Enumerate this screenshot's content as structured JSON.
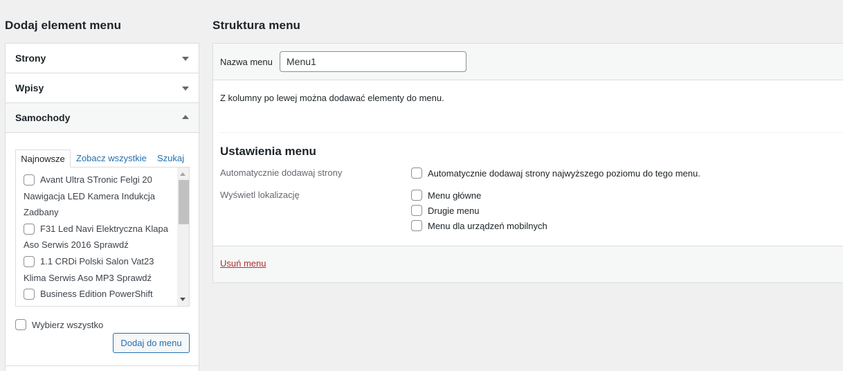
{
  "left": {
    "heading": "Dodaj element menu",
    "sections": [
      {
        "label": "Strony",
        "state": "collapsed"
      },
      {
        "label": "Wpisy",
        "state": "collapsed"
      },
      {
        "label": "Samochody",
        "state": "expanded"
      }
    ],
    "tabs": [
      "Najnowsze",
      "Zobacz wszystkie",
      "Szukaj"
    ],
    "items": [
      {
        "line1": "Avant Ultra STronic Felgi 20",
        "line2": "Nawigacja LED Kamera Indukcja",
        "line3": "Zadbany"
      },
      {
        "line1": "F31 Led Navi Elektryczna Klapa",
        "line2": "Aso Serwis 2016 Sprawdź"
      },
      {
        "line1": "1.1 CRDi Polski Salon Vat23",
        "line2": "Klima Serwis Aso MP3 Sprawdź"
      },
      {
        "line1": "Business Edition PowerShift"
      }
    ],
    "select_all": "Wybierz wszystko",
    "add_button": "Dodaj do menu"
  },
  "right": {
    "heading": "Struktura menu",
    "name_label": "Nazwa menu",
    "name_value": "Menu1",
    "info": "Z kolumny po lewej można dodawać elementy do menu.",
    "settings_title": "Ustawienia menu",
    "auto_add_label": "Automatycznie dodawaj strony",
    "auto_add_option": "Automatycznie dodawaj strony najwyższego poziomu do tego menu.",
    "locations_label": "Wyświetl lokalizację",
    "locations": [
      "Menu główne",
      "Drugie menu",
      "Menu dla urządzeń mobilnych"
    ],
    "delete_link": "Usuń menu"
  },
  "colors": {
    "background": "#f0f0f1",
    "accent": "#2271b1",
    "danger": "#b32d2e",
    "border": "#dcdcde"
  }
}
